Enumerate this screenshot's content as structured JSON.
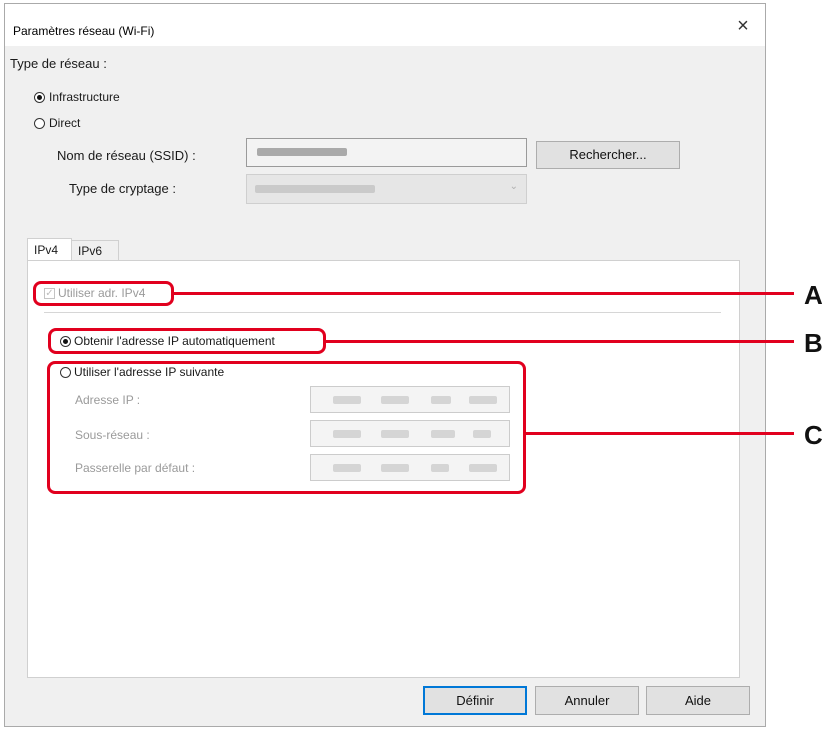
{
  "window": {
    "title": "Paramètres réseau (Wi-Fi)",
    "close_glyph": "×"
  },
  "network_type": {
    "label": "Type de réseau :",
    "options": [
      {
        "label": "Infrastructure",
        "selected": true
      },
      {
        "label": "Direct",
        "selected": false
      }
    ],
    "ssid_label": "Nom de réseau (SSID) :",
    "search_button": "Rechercher...",
    "encryption_label": "Type de cryptage :"
  },
  "tabs": [
    {
      "label": "IPv4",
      "active": true
    },
    {
      "label": "IPv6",
      "active": false
    }
  ],
  "ipv4": {
    "use_ipv4_label": "Utiliser adr. IPv4",
    "use_ipv4_checked": true,
    "auto_ip_label": "Obtenir l'adresse IP automatiquement",
    "manual_ip_label": "Utiliser l'adresse IP suivante",
    "ip_address_label": "Adresse IP :",
    "subnet_label": "Sous-réseau :",
    "gateway_label": "Passerelle par défaut :"
  },
  "buttons": {
    "ok": "Définir",
    "cancel": "Annuler",
    "help": "Aide"
  },
  "annotations": {
    "a": "A",
    "b": "B",
    "c": "C",
    "color": "#e1001e"
  }
}
